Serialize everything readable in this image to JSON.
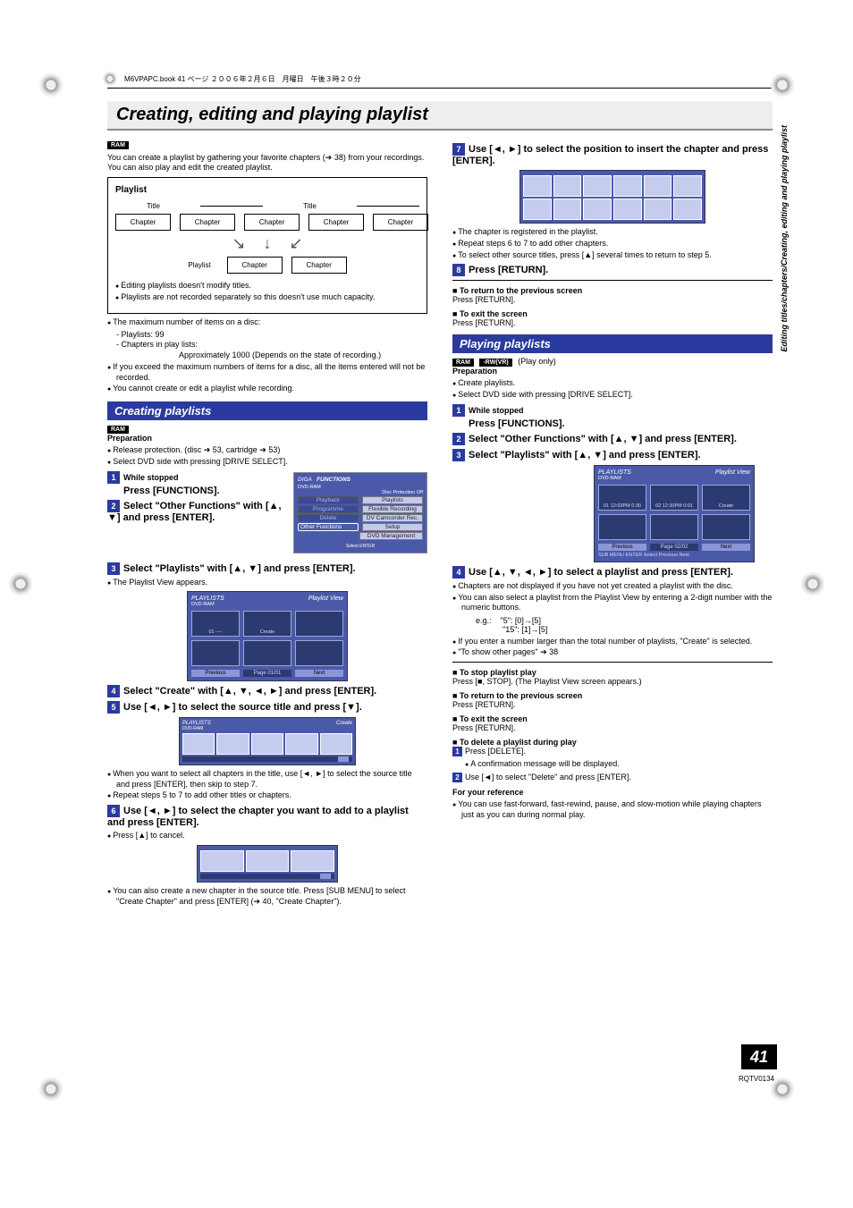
{
  "meta": {
    "book_line": "M6VPAPC.book  41 ページ  ２００６年２月６日　月曜日　午後３時２０分",
    "side_label": "Editing titles/chapters/Creating, editing and playing playlist",
    "page_number": "41",
    "page_code": "RQTV0134"
  },
  "title": "Creating, editing and playing playlist",
  "badges": {
    "ram": "RAM",
    "rwvr": "-RW(VR)"
  },
  "intro": "You can create a playlist by gathering your favorite chapters (➔ 38) from your recordings. You can also play and edit the created playlist.",
  "diagram": {
    "box_title": "Playlist",
    "title_label": "Title",
    "chapter_label": "Chapter",
    "playlist_label": "Playlist",
    "notes": [
      "Editing playlists doesn't modify titles.",
      "Playlists are not recorded separately so this doesn't use much capacity."
    ]
  },
  "left_notes": {
    "bullet1": "The maximum number of items on a disc:",
    "dash1": "Playlists:    99",
    "dash2": "Chapters in play lists:",
    "dash2_sub": "Approximately 1000 (Depends on the state of recording.)",
    "bullet2": "If you exceed the maximum numbers of items for a disc, all the items entered will not be recorded.",
    "bullet3": "You cannot create or edit a playlist while recording."
  },
  "creating": {
    "heading": "Creating playlists",
    "prep_label": "Preparation",
    "prep_items": [
      "Release protection. (disc ➔ 53, cartridge ➔ 53)",
      "Select DVD side with pressing [DRIVE SELECT]."
    ],
    "steps": {
      "s1_pre": "While stopped",
      "s1": "Press [FUNCTIONS].",
      "s2": "Select \"Other Functions\" with [▲, ▼] and press [ENTER].",
      "s3": "Select \"Playlists\" with [▲, ▼] and press [ENTER].",
      "s3_note": "The Playlist View appears.",
      "s4": "Select \"Create\" with [▲, ▼, ◄, ►] and press [ENTER].",
      "s5": "Use [◄, ►] to select the source title and press [▼].",
      "s5_note1": "When you want to select all chapters in the title, use [◄, ►] to select the source title and press [ENTER], then skip to step 7.",
      "s5_note2": "Repeat steps 5 to 7 to add other titles or chapters.",
      "s6": "Use [◄, ►] to select the chapter you want to add to a playlist and press [ENTER].",
      "s6_note1": "Press [▲] to cancel.",
      "s6_note2": "You can also create a new chapter in the source title. Press [SUB MENU] to select \"Create Chapter\" and press [ENTER] (➔ 40, \"Create Chapter\")."
    },
    "fn_panel": {
      "brand": "DIGA",
      "title": "FUNCTIONS",
      "dvd": "DVD-RAM",
      "right_top": "Disc Protection Off",
      "left": [
        "Playback",
        "Programme",
        "Delete",
        "Other Functions"
      ],
      "right": [
        "Playlists",
        "Flexible Recording",
        "DV Camcorder Rec.",
        "Setup",
        "DVD Management"
      ],
      "footer": "Select   ENTER"
    },
    "plview": {
      "title": "PLAYLISTS",
      "sub": "Playlist View",
      "dvd": "DVD-RAM",
      "thumb1": "01 ----",
      "thumb2": "Create",
      "prev": "Previous",
      "page": "Page  01/01",
      "next": "Next"
    },
    "strip": {
      "title": "PLAYLISTS",
      "sub": "Create",
      "dvd": "DVD-RAM"
    }
  },
  "right": {
    "s7": "Use [◄, ►] to select the position to insert the chapter and press [ENTER].",
    "s7_notes": [
      "The chapter is registered in the playlist.",
      "Repeat steps 6 to 7 to add other chapters.",
      "To select other source titles, press [▲] several times to return to step 5."
    ],
    "s8": "Press [RETURN].",
    "return_prev_h": "To return to the previous screen",
    "return_prev_t": "Press [RETURN].",
    "exit_h": "To exit the screen",
    "exit_t": "Press [RETURN].",
    "play_heading": "Playing playlists",
    "play_only": "(Play only)",
    "prep_label": "Preparation",
    "prep_items": [
      "Create playlists.",
      "Select DVD side with pressing [DRIVE SELECT]."
    ],
    "s1_pre": "While stopped",
    "s1": "Press [FUNCTIONS].",
    "s2": "Select \"Other Functions\" with [▲, ▼] and press [ENTER].",
    "s3": "Select \"Playlists\" with [▲, ▼] and press [ENTER].",
    "plview": {
      "title": "PLAYLISTS",
      "sub": "Playlist View",
      "dvd": "DVD-RAM",
      "thumb1": "01 12:03PM 0:30",
      "thumb2": "02 12:30PM 0:01",
      "thumb3": "Create",
      "prev": "Previous",
      "page": "Page  02/02",
      "next": "Next",
      "footer_icons": "SUB MENU   ENTER Select   Previous   Next"
    },
    "s4": "Use [▲, ▼, ◄, ►] to select a playlist and press [ENTER].",
    "s4_notes": {
      "n1": "Chapters are not displayed if you have not yet created a playlist with the disc.",
      "n2": "You can also select a playlist from the Playlist View by entering a 2-digit number with the numeric buttons.",
      "eg_label": "e.g.:",
      "eg1": "\"5\":    [0]→[5]",
      "eg2": "\"15\":   [1]→[5]",
      "n3": "If you enter a number larger than the total number of playlists, \"Create\" is selected.",
      "n4": "\"To show other pages\" ➔ 38"
    },
    "stop_h": "To stop playlist play",
    "stop_t": "Press [■, STOP]. (The Playlist View screen appears.)",
    "return2_h": "To return to the previous screen",
    "return2_t": "Press [RETURN].",
    "exit2_h": "To exit the screen",
    "exit2_t": "Press [RETURN].",
    "del_h": "To delete a playlist during play",
    "del_s1": "Press [DELETE].",
    "del_s1_note": "A confirmation message will be displayed.",
    "del_s2": "Use [◄] to select \"Delete\" and press [ENTER].",
    "ref_h": "For your reference",
    "ref_t": "You can use fast-forward, fast-rewind, pause, and slow-motion while playing chapters just as you can during normal play."
  }
}
